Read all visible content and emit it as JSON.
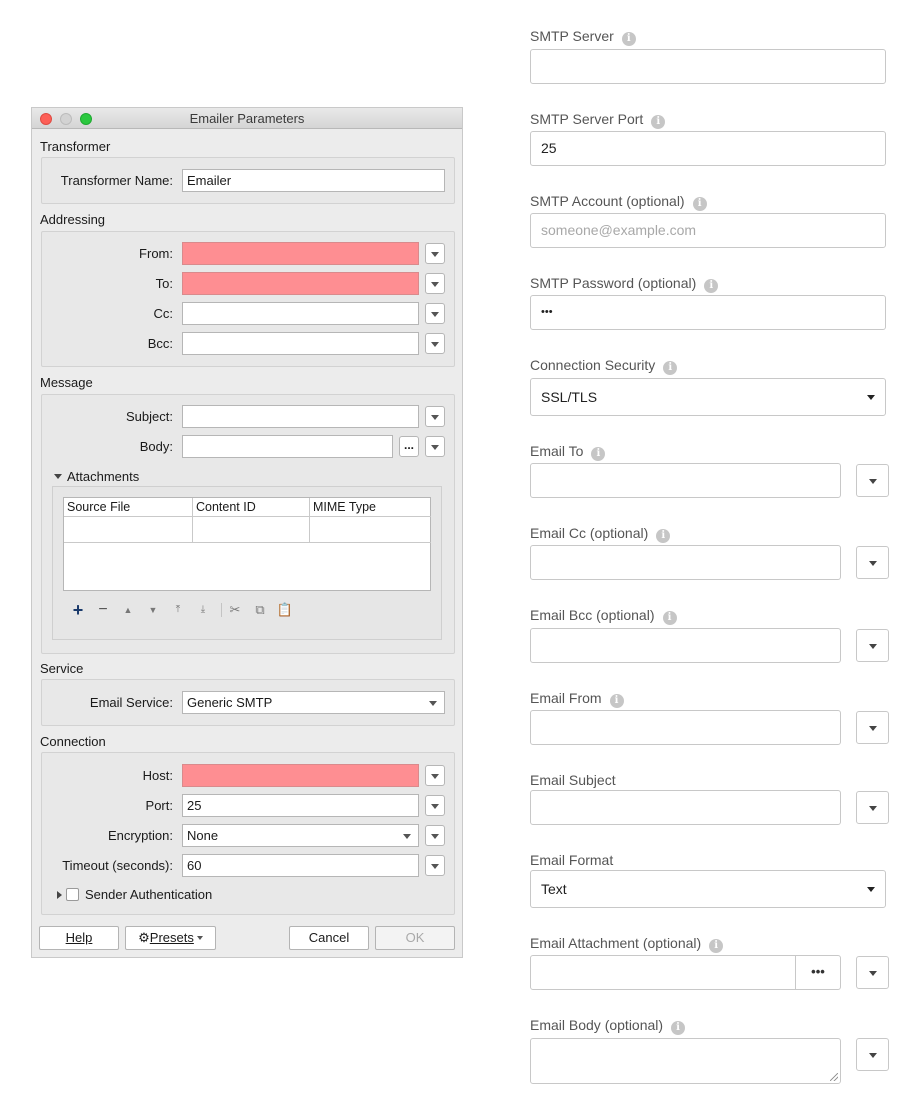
{
  "dialog": {
    "title": "Emailer Parameters",
    "sections": {
      "transformer": "Transformer",
      "addressing": "Addressing",
      "message": "Message",
      "service": "Service",
      "connection": "Connection"
    },
    "transformer_name_label": "Transformer Name:",
    "transformer_name_value": "Emailer",
    "from_label": "From:",
    "to_label": "To:",
    "cc_label": "Cc:",
    "bcc_label": "Bcc:",
    "subject_label": "Subject:",
    "body_label": "Body:",
    "body_button": "...",
    "attachments_label": "Attachments",
    "attachments_columns": [
      "Source File",
      "Content ID",
      "MIME Type"
    ],
    "email_service_label": "Email Service:",
    "email_service_value": "Generic SMTP",
    "host_label": "Host:",
    "port_label": "Port:",
    "port_value": "25",
    "encryption_label": "Encryption:",
    "encryption_value": "None",
    "timeout_label": "Timeout (seconds):",
    "timeout_value": "60",
    "sender_auth_label": "Sender Authentication",
    "buttons": {
      "help": "Help",
      "presets": "Presets",
      "cancel": "Cancel",
      "ok": "OK"
    },
    "required_color": "#fe8e92"
  },
  "webform": {
    "smtp_server_label": "SMTP Server",
    "smtp_server_value": "",
    "smtp_port_label": "SMTP Server Port",
    "smtp_port_value": "25",
    "smtp_account_label": "SMTP Account (optional)",
    "smtp_account_placeholder": "someone@example.com",
    "smtp_password_label": "SMTP Password (optional)",
    "smtp_password_value": "•••",
    "connection_security_label": "Connection Security",
    "connection_security_value": "SSL/TLS",
    "email_to_label": "Email To",
    "email_cc_label": "Email Cc (optional)",
    "email_bcc_label": "Email Bcc (optional)",
    "email_from_label": "Email From",
    "email_subject_label": "Email Subject",
    "email_format_label": "Email Format",
    "email_format_value": "Text",
    "email_attachment_label": "Email Attachment (optional)",
    "email_attachment_button": "•••",
    "email_body_label": "Email Body (optional)",
    "info_glyph": "i"
  }
}
